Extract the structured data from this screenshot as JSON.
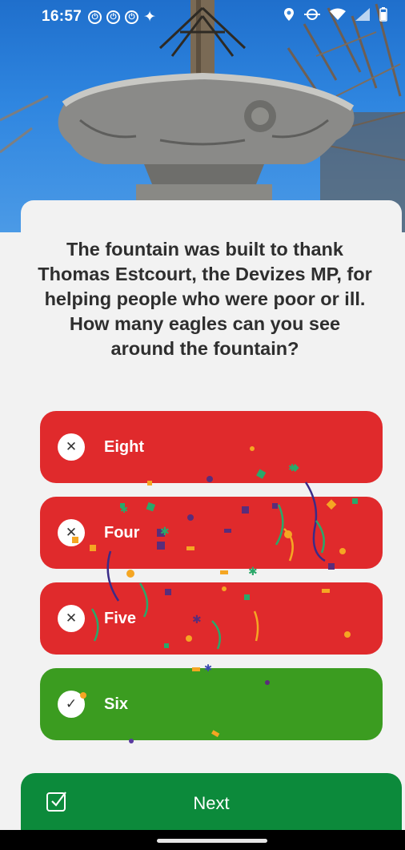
{
  "status_bar": {
    "time": "16:57"
  },
  "question": {
    "text": "The fountain was built to thank Thomas Estcourt, the Devizes MP, for helping people who were poor or ill. How many eagles can you see around the fountain?"
  },
  "answers": [
    {
      "label": "Eight",
      "state": "wrong",
      "icon": "cross-icon"
    },
    {
      "label": "Four",
      "state": "wrong",
      "icon": "cross-icon"
    },
    {
      "label": "Five",
      "state": "wrong",
      "icon": "cross-icon"
    },
    {
      "label": "Six",
      "state": "correct",
      "icon": "check-icon"
    }
  ],
  "next": {
    "label": "Next",
    "icon": "checkbox-icon"
  },
  "colors": {
    "wrong": "#e02a2c",
    "correct": "#3b9c20",
    "next": "#0c8a3b"
  }
}
